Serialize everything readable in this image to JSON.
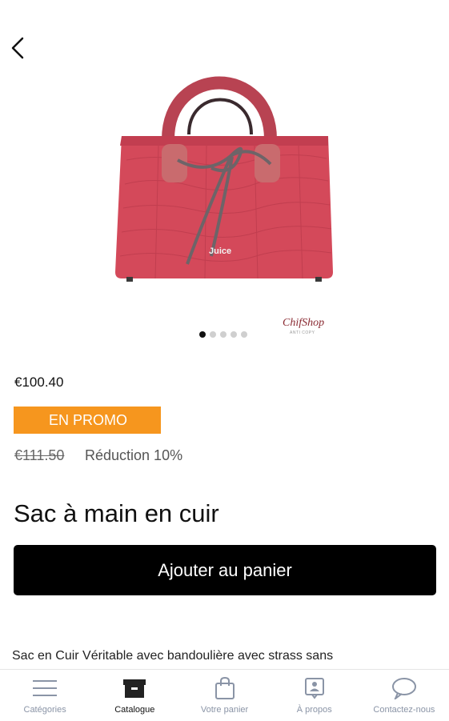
{
  "carousel": {
    "watermark": "ChifShop",
    "watermark_sub": "ANTI COPY",
    "bag_logo": "Juice",
    "slides": 5,
    "active_slide": 1
  },
  "product": {
    "price": "€100.40",
    "promo_label": "EN PROMO",
    "old_price": "€111.50",
    "discount": "Réduction 10%",
    "title": "Sac à main en cuir",
    "add_to_cart": "Ajouter au panier",
    "description": "Sac en Cuir Véritable avec bandoulière avec strass sans"
  },
  "nav": {
    "categories": "Catégories",
    "catalogue": "Catalogue",
    "cart": "Votre panier",
    "about": "À propos",
    "contact": "Contactez-nous",
    "active": "Catalogue"
  },
  "colors": {
    "promo": "#f6961e",
    "button": "#000000",
    "bag": "#d4495a",
    "nav_inactive": "#8a94a6"
  }
}
